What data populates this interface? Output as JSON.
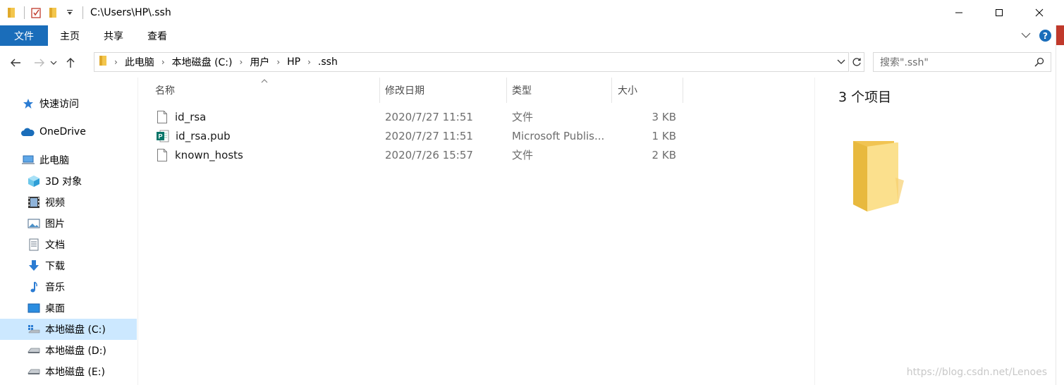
{
  "window": {
    "title": "C:\\Users\\HP\\.ssh"
  },
  "ribbon": {
    "tabs": [
      "文件",
      "主页",
      "共享",
      "查看"
    ]
  },
  "address": {
    "crumbs": [
      "此电脑",
      "本地磁盘 (C:)",
      "用户",
      "HP",
      ".ssh"
    ]
  },
  "search": {
    "placeholder": "搜索\".ssh\""
  },
  "nav": {
    "quick_access": "快速访问",
    "onedrive": "OneDrive",
    "this_pc": "此电脑",
    "items": [
      {
        "label": "3D 对象",
        "icon": "3d-objects-icon"
      },
      {
        "label": "视频",
        "icon": "video-icon"
      },
      {
        "label": "图片",
        "icon": "pictures-icon"
      },
      {
        "label": "文档",
        "icon": "documents-icon"
      },
      {
        "label": "下载",
        "icon": "download-icon"
      },
      {
        "label": "音乐",
        "icon": "music-icon"
      },
      {
        "label": "桌面",
        "icon": "desktop-icon"
      },
      {
        "label": "本地磁盘 (C:)",
        "icon": "drive-c-icon",
        "selected": true
      },
      {
        "label": "本地磁盘 (D:)",
        "icon": "drive-icon"
      },
      {
        "label": "本地磁盘 (E:)",
        "icon": "drive-icon"
      }
    ]
  },
  "columns": {
    "name": "名称",
    "modified": "修改日期",
    "type": "类型",
    "size": "大小"
  },
  "files": [
    {
      "name": "id_rsa",
      "modified": "2020/7/27 11:51",
      "type": "文件",
      "size": "3 KB",
      "icon": "blank-file-icon"
    },
    {
      "name": "id_rsa.pub",
      "modified": "2020/7/27 11:51",
      "type": "Microsoft Publis...",
      "size": "1 KB",
      "icon": "publisher-file-icon"
    },
    {
      "name": "known_hosts",
      "modified": "2020/7/26 15:57",
      "type": "文件",
      "size": "2 KB",
      "icon": "blank-file-icon"
    }
  ],
  "preview": {
    "item_count": "3 个项目"
  },
  "watermark": "https://blog.csdn.net/Lenoes",
  "colors": {
    "accent": "#1a6dba",
    "selection": "#cce8ff",
    "folder": "#f8d775"
  }
}
